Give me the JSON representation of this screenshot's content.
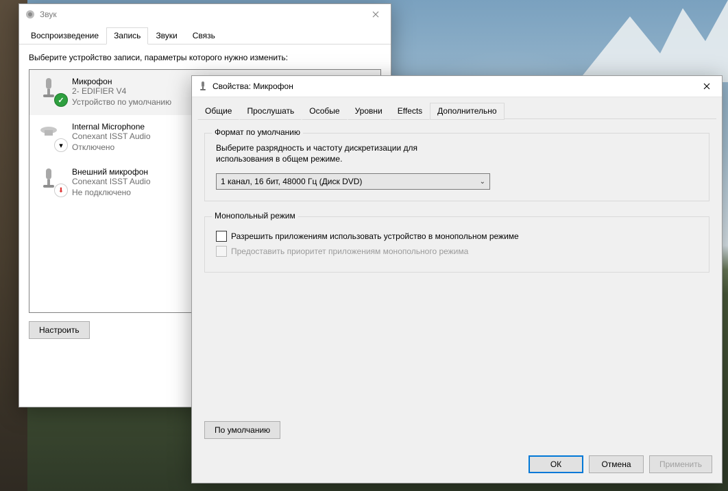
{
  "sound_window": {
    "title": "Звук",
    "tabs": {
      "playback": "Воспроизведение",
      "recording": "Запись",
      "sounds": "Звуки",
      "comm": "Связь"
    },
    "instruction": "Выберите устройство записи, параметры которого нужно изменить:",
    "devices": [
      {
        "name": "Микрофон",
        "driver": "2- EDIFIER V4",
        "status": "Устройство по умолчанию"
      },
      {
        "name": "Internal Microphone",
        "driver": "Conexant ISST Audio",
        "status": "Отключено"
      },
      {
        "name": "Внешний микрофон",
        "driver": "Conexant ISST Audio",
        "status": "Не подключено"
      }
    ],
    "configure_btn": "Настроить"
  },
  "props_window": {
    "title": "Свойства: Микрофон",
    "tabs": {
      "general": "Общие",
      "listen": "Прослушать",
      "custom": "Особые",
      "levels": "Уровни",
      "effects": "Effects",
      "advanced": "Дополнительно"
    },
    "group_format": {
      "title": "Формат по умолчанию",
      "desc_line1": "Выберите разрядность и частоту дискретизации для",
      "desc_line2": "использования в общем режиме.",
      "selected": "1 канал, 16 бит, 48000 Гц (Диск DVD)"
    },
    "group_exclusive": {
      "title": "Монопольный режим",
      "allow": "Разрешить приложениям использовать устройство в монопольном режиме",
      "priority": "Предоставить приоритет приложениям монопольного режима"
    },
    "default_btn": "По умолчанию",
    "ok_btn": "ОК",
    "cancel_btn": "Отмена",
    "apply_btn": "Применить"
  }
}
